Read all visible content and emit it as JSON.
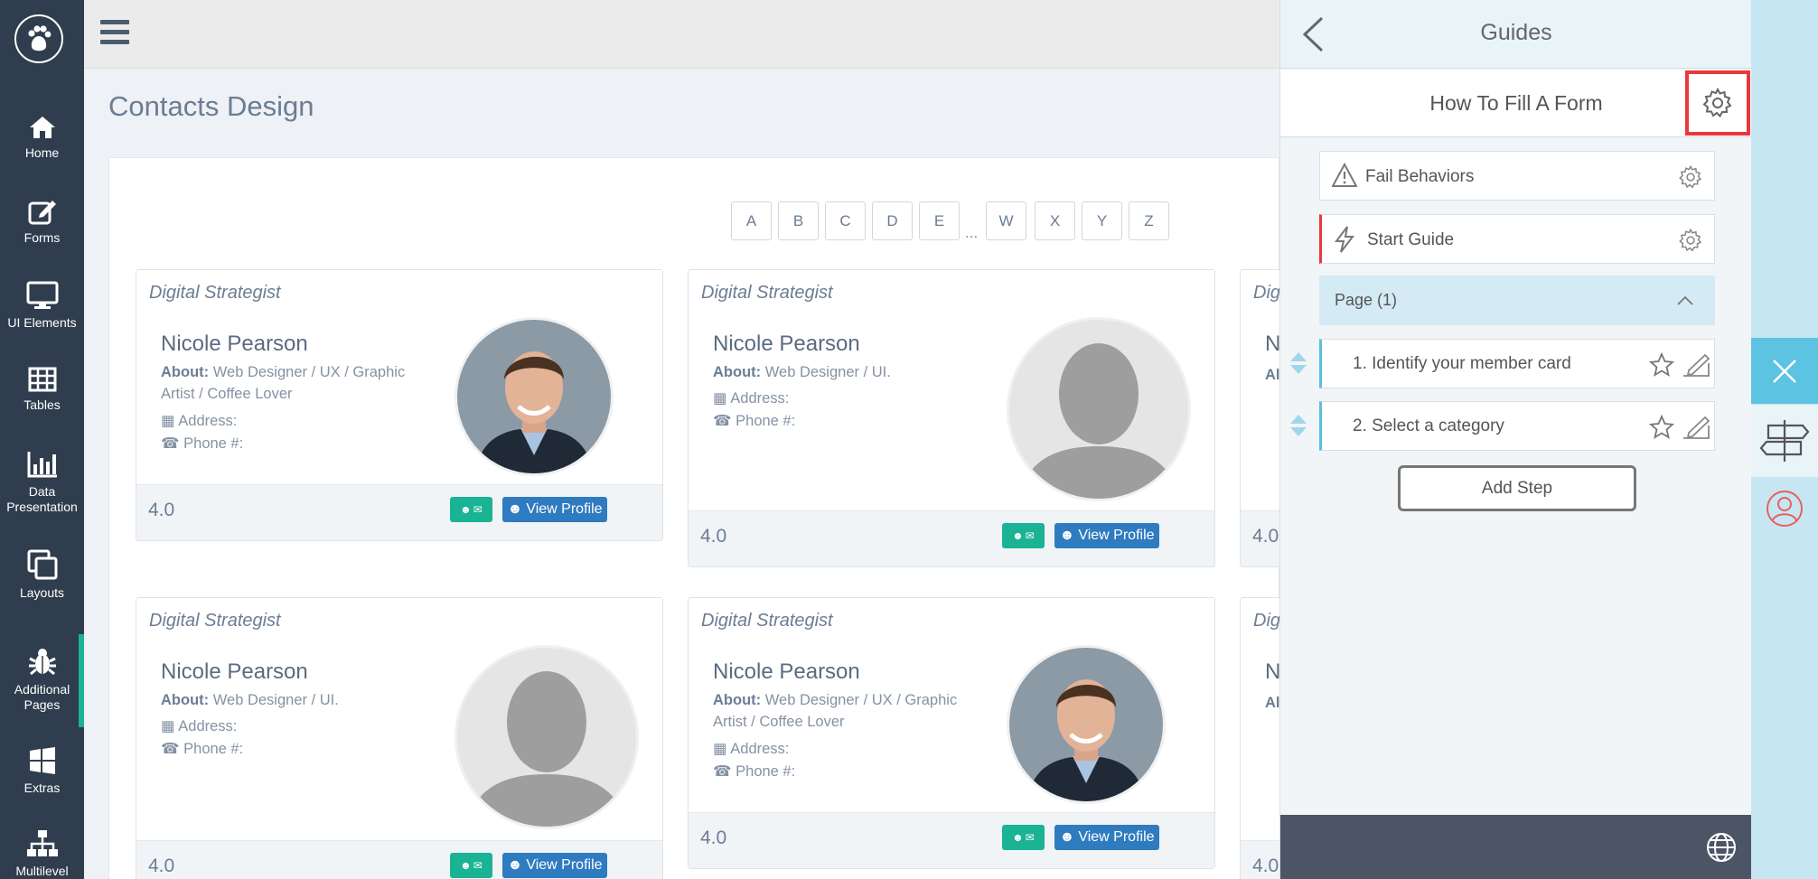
{
  "nav": {
    "items": [
      {
        "label": "Home",
        "icon": "home-icon"
      },
      {
        "label": "Forms",
        "icon": "edit-icon"
      },
      {
        "label": "UI Elements",
        "icon": "monitor-icon"
      },
      {
        "label": "Tables",
        "icon": "table-icon"
      },
      {
        "label": "Data Presentation",
        "icon": "bar-chart-icon"
      },
      {
        "label": "Layouts",
        "icon": "copy-icon"
      },
      {
        "label": "Additional Pages",
        "icon": "bug-icon"
      },
      {
        "label": "Extras",
        "icon": "windows-icon"
      },
      {
        "label": "Multilevel",
        "icon": "sitemap-icon"
      }
    ]
  },
  "page": {
    "title": "Contacts Design"
  },
  "alphabet": [
    "A",
    "B",
    "C",
    "D",
    "E",
    "...",
    "W",
    "X",
    "Y",
    "Z"
  ],
  "cards": [
    {
      "role": "Digital Strategist",
      "name": "Nicole Pearson",
      "about_label": "About:",
      "about": "Web Designer / UX / Graphic Artist / Coffee Lover",
      "address_label": "Address:",
      "phone_label": "Phone #:",
      "rating": "4.0",
      "view_label": "View Profile",
      "photo": "male-photo"
    },
    {
      "role": "Digital Strategist",
      "name": "Nicole Pearson",
      "about_label": "About:",
      "about": "Web Designer / UI.",
      "address_label": "Address:",
      "phone_label": "Phone #:",
      "rating": "4.0",
      "view_label": "View Profile",
      "photo": "placeholder-avatar"
    },
    {
      "role": "Dig",
      "name": "N",
      "about_label": "Al",
      "rating": "4.0"
    },
    {
      "role": "Digital Strategist",
      "name": "Nicole Pearson",
      "about_label": "About:",
      "about": "Web Designer / UI.",
      "address_label": "Address:",
      "phone_label": "Phone #:",
      "rating": "4.0",
      "view_label": "View Profile",
      "photo": "placeholder-avatar"
    },
    {
      "role": "Digital Strategist",
      "name": "Nicole Pearson",
      "about_label": "About:",
      "about": "Web Designer / UX / Graphic Artist / Coffee Lover",
      "address_label": "Address:",
      "phone_label": "Phone #:",
      "rating": "4.0",
      "view_label": "View Profile",
      "photo": "male-photo"
    },
    {
      "role": "Dig",
      "name": "N",
      "about_label": "Al",
      "rating": "4.0"
    }
  ],
  "guides": {
    "title": "Guides",
    "guide_name": "How To Fill A Form",
    "fail_behaviors": "Fail Behaviors",
    "start_guide": "Start Guide",
    "page_label": "Page (1)",
    "steps": [
      "1.  Identify your member card",
      "2.  Select a category"
    ],
    "add_step": "Add Step"
  },
  "colors": {
    "nav_bg": "#2f3d4e",
    "accent_green": "#1ab394",
    "button_blue": "#2f7bbf",
    "highlight_red": "#e8383d",
    "rail_blue": "#5cc3e3"
  }
}
